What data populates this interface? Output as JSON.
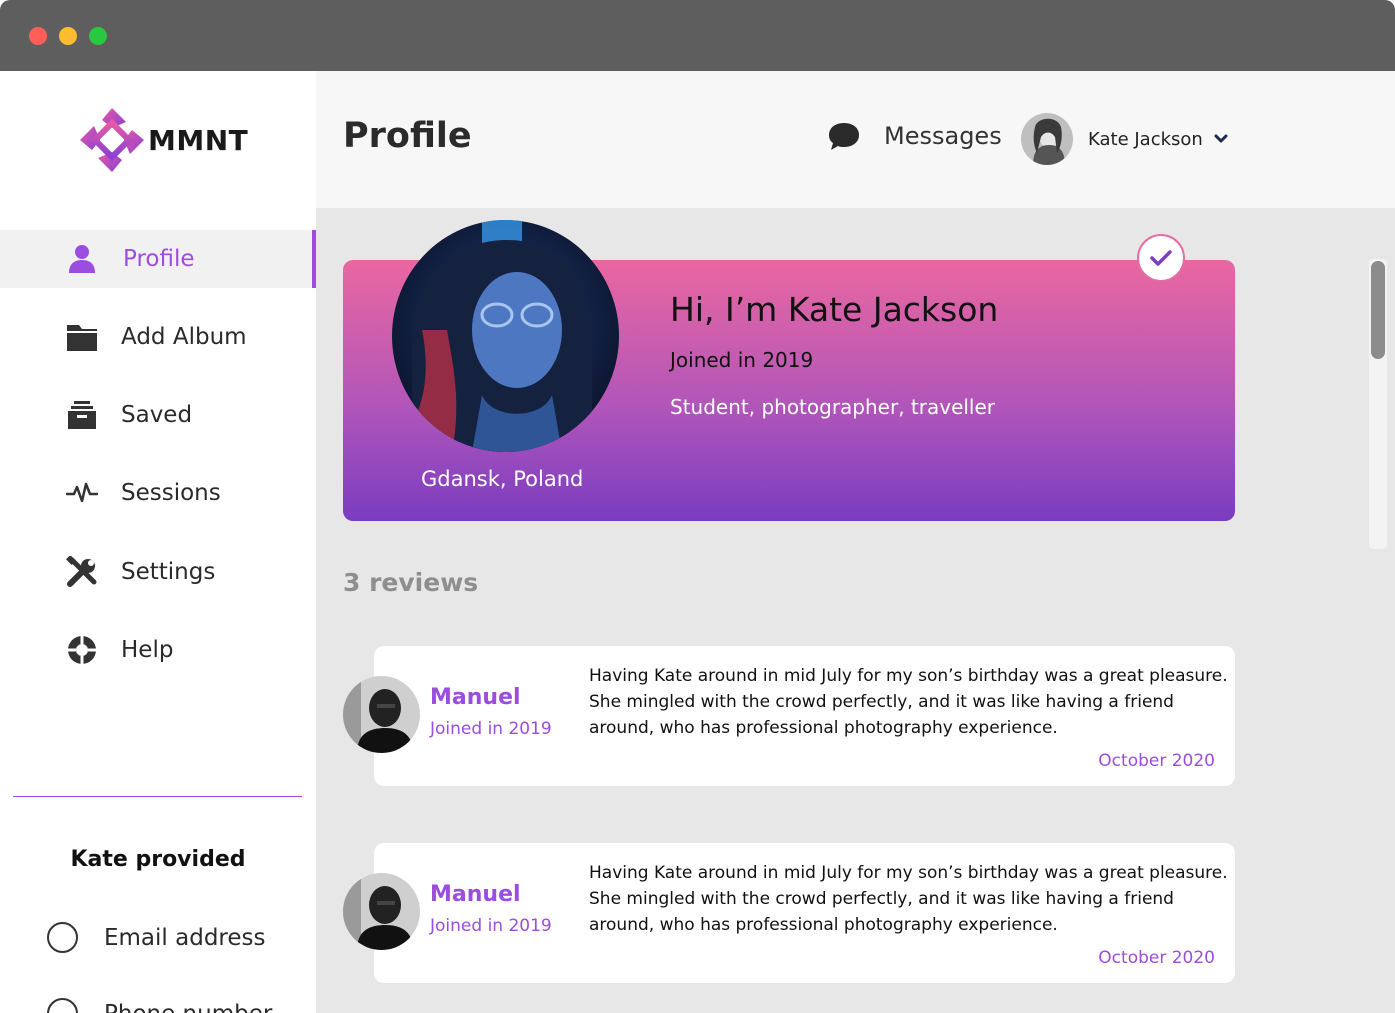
{
  "window": {
    "controls": [
      "close",
      "minimize",
      "maximize"
    ]
  },
  "brand": {
    "name": "MMNT",
    "accent": "#9b4de0",
    "logo_colors": [
      "#e85aa5",
      "#9b4de0"
    ]
  },
  "sidebar": {
    "items": [
      {
        "label": "Profile",
        "icon": "user-icon",
        "active": true
      },
      {
        "label": "Add Album",
        "icon": "folder-icon",
        "active": false
      },
      {
        "label": "Saved",
        "icon": "archive-icon",
        "active": false
      },
      {
        "label": "Sessions",
        "icon": "activity-icon",
        "active": false
      },
      {
        "label": "Settings",
        "icon": "tools-icon",
        "active": false
      },
      {
        "label": "Help",
        "icon": "lifebuoy-icon",
        "active": false
      }
    ],
    "provided": {
      "title": "Kate provided",
      "items": [
        "Email address",
        "Phone number"
      ]
    }
  },
  "header": {
    "title": "Profile",
    "messages_label": "Messages",
    "user_name": "Kate Jackson"
  },
  "profile": {
    "greeting": "Hi, I’m Kate Jackson",
    "joined": "Joined in 2019",
    "bio": "Student, photographer, traveller",
    "location": "Gdansk, Poland",
    "verified": true
  },
  "reviews": {
    "count_label": "3 reviews",
    "items": [
      {
        "name": "Manuel",
        "joined": "Joined in 2019",
        "text": "Having Kate around in mid July for my son’s birthday was a great pleasure. She mingled with the crowd perfectly, and it was like having a friend around, who has professional photography experience.",
        "date": "October 2020"
      },
      {
        "name": "Manuel",
        "joined": "Joined in 2019",
        "text": "Having Kate around in mid July for my son’s birthday was a great pleasure. She mingled with the crowd perfectly, and it was like having a friend around, who has professional photography experience.",
        "date": "October 2020"
      }
    ]
  }
}
